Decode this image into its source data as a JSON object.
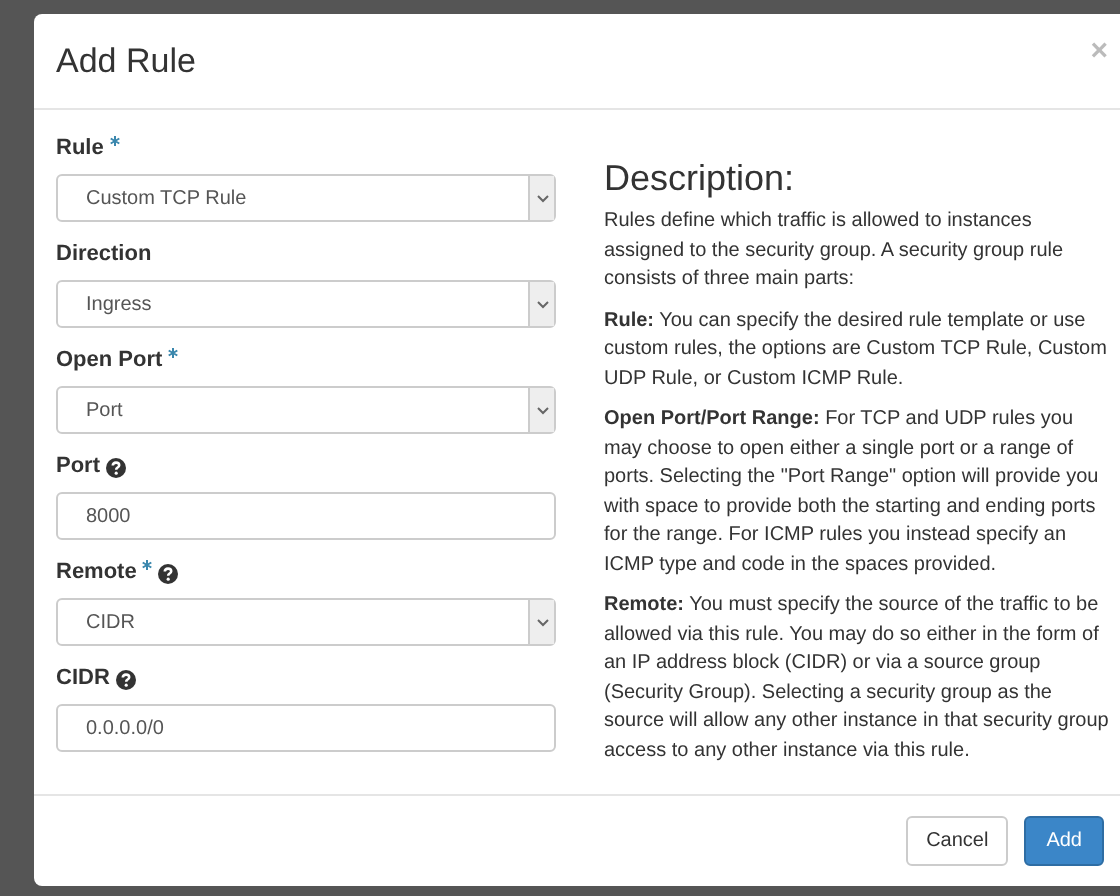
{
  "dialog": {
    "title": "Add Rule",
    "close": "×"
  },
  "fields": [
    {
      "label": "Rule",
      "required": true,
      "help": false,
      "kind": "select",
      "value": "Custom TCP Rule"
    },
    {
      "label": "Direction",
      "required": false,
      "help": false,
      "kind": "select",
      "value": "Ingress"
    },
    {
      "label": "Open Port",
      "required": true,
      "help": false,
      "kind": "select",
      "value": "Port"
    },
    {
      "label": "Port",
      "required": false,
      "help": true,
      "kind": "text",
      "value": "8000"
    },
    {
      "label": "Remote",
      "required": true,
      "help": true,
      "kind": "select",
      "value": "CIDR"
    },
    {
      "label": "CIDR",
      "required": false,
      "help": true,
      "kind": "text",
      "value": "0.0.0.0/0"
    }
  ],
  "description": {
    "title": "Description:",
    "paragraphs": [
      "Rules define which traffic is allowed to instances assigned to the security group. A security group rule consists of three main parts:",
      "**Rule:** You can specify the desired rule template or use custom rules, the options are Custom TCP Rule, Custom UDP Rule, or Custom ICMP Rule.",
      "**Open Port/Port Range:** For TCP and UDP rules you may choose to open either a single port or a range of ports. Selecting the \"Port Range\" option will provide you with space to provide both the starting and ending ports for the range. For ICMP rules you instead specify an ICMP type and code in the spaces provided.",
      "**Remote:** You must specify the source of the traffic to be allowed via this rule. You may do so either in the form of an IP address block (CIDR) or via a source group (Security Group). Selecting a security group as the source will allow any other instance in that security group access to any other instance via this rule."
    ]
  },
  "buttons": [
    {
      "label": "Cancel",
      "kind": "default"
    },
    {
      "label": "Add",
      "kind": "primary"
    }
  ]
}
